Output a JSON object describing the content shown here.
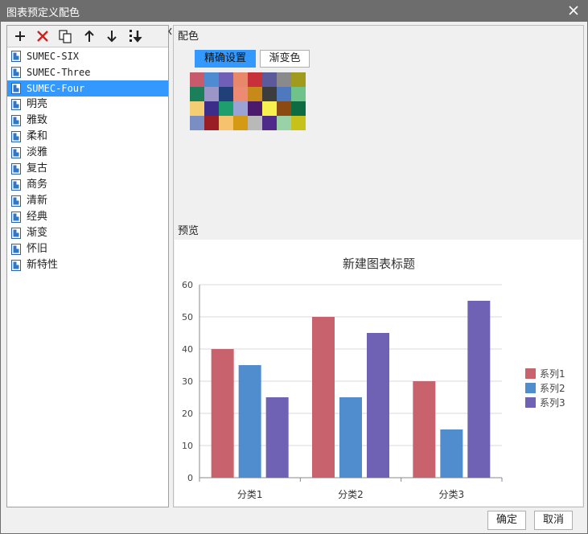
{
  "window": {
    "title": "图表预定义配色"
  },
  "toolbar": {
    "add_icon": "plus-icon",
    "delete_icon": "red-x-icon",
    "copy_icon": "copy-icon",
    "up_icon": "arrow-up-icon",
    "down_icon": "arrow-down-icon",
    "sort_icon": "sort-down-icon"
  },
  "schemes": [
    {
      "label": "SUMEC-SIX"
    },
    {
      "label": "SUMEC-Three"
    },
    {
      "label": "SUMEC-Four",
      "selected": true
    },
    {
      "label": "明亮"
    },
    {
      "label": "雅致"
    },
    {
      "label": "柔和"
    },
    {
      "label": "淡雅"
    },
    {
      "label": "复古"
    },
    {
      "label": "商务"
    },
    {
      "label": "清新"
    },
    {
      "label": "经典"
    },
    {
      "label": "渐变"
    },
    {
      "label": "怀旧"
    },
    {
      "label": "新特性"
    }
  ],
  "palette_section": {
    "label": "配色",
    "tabs": [
      {
        "label": "精确设置",
        "active": true
      },
      {
        "label": "渐变色",
        "active": false
      }
    ],
    "swatches": [
      "#c75b6b",
      "#4d8cd0",
      "#6f5fb6",
      "#e8886a",
      "#c7323a",
      "#5b5b9c",
      "#8a8a8a",
      "#a19b1d",
      "#1b8059",
      "#9c95c8",
      "#213f78",
      "#ec8a73",
      "#c8891b",
      "#3d3d3d",
      "#4e79bf",
      "#6ec28a",
      "#f5cd73",
      "#3d2d8a",
      "#1e9e6e",
      "#9aa3d4",
      "#4c1a6c",
      "#f7f04e",
      "#8b4a12",
      "#0e6c43",
      "#7b8ec4",
      "#9a1c24",
      "#f6c26d",
      "#d59a14",
      "#b9b9b9",
      "#4f2a8a",
      "#99d2a6",
      "#c6c11b"
    ]
  },
  "preview_section": {
    "label": "预览"
  },
  "chart_data": {
    "type": "bar",
    "title": "新建图表标题",
    "categories": [
      "分类1",
      "分类2",
      "分类3"
    ],
    "series": [
      {
        "name": "系列1",
        "values": [
          40,
          50,
          30
        ],
        "color": "#c8636d"
      },
      {
        "name": "系列2",
        "values": [
          35,
          25,
          15
        ],
        "color": "#4f8dce"
      },
      {
        "name": "系列3",
        "values": [
          25,
          45,
          55
        ],
        "color": "#6f62b5"
      }
    ],
    "ylim": [
      0,
      60
    ],
    "yticks": [
      0,
      10,
      20,
      30,
      40,
      50,
      60
    ],
    "grid": true,
    "legend": "right"
  },
  "buttons": {
    "ok": "确定",
    "cancel": "取消"
  }
}
